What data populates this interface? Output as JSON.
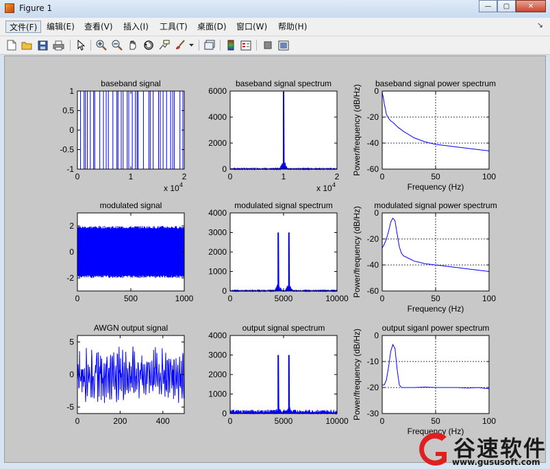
{
  "window": {
    "title": "Figure 1",
    "buttons": {
      "minimize": "—",
      "maximize": "▢",
      "close": "✕"
    }
  },
  "menu": {
    "items": [
      "文件(F)",
      "编辑(E)",
      "查看(V)",
      "插入(I)",
      "工具(T)",
      "桌面(D)",
      "窗口(W)",
      "帮助(H)"
    ],
    "overflow": "↘"
  },
  "toolbar": {
    "icons": [
      "new-figure-icon",
      "open-file-icon",
      "save-icon",
      "print-icon",
      "pointer-icon",
      "zoom-in-icon",
      "zoom-out-icon",
      "pan-icon",
      "rotate-3d-icon",
      "data-cursor-icon",
      "brush-icon",
      "link-icon",
      "colorbar-icon",
      "legend-icon",
      "hide-plot-tools-icon",
      "show-plot-tools-icon"
    ]
  },
  "colors": {
    "line": "#0000ff",
    "axes_bg": "#ffffff",
    "figure_bg": "#c8c8c8",
    "watermark_red": "#e02020"
  },
  "chart_data": [
    {
      "type": "line",
      "title": "baseband signal",
      "xlabel": "",
      "ylabel": "",
      "xlim": [
        0,
        20000
      ],
      "ylim": [
        -1,
        1
      ],
      "xticks": [
        "0",
        "1",
        "2"
      ],
      "yticks": [
        "-1",
        "-0.5",
        "0",
        "0.5",
        "1"
      ],
      "x_exponent": "x 10^4",
      "grid": false,
      "series": [
        {
          "kind": "square-wave",
          "values": [
            1,
            -1
          ]
        }
      ]
    },
    {
      "type": "line",
      "title": "baseband signal spectrum",
      "xlabel": "",
      "ylabel": "",
      "xlim": [
        0,
        20000
      ],
      "ylim": [
        0,
        6000
      ],
      "xticks": [
        "0",
        "1",
        "2"
      ],
      "yticks": [
        "0",
        "2000",
        "4000",
        "6000"
      ],
      "x_exponent": "x 10^4",
      "grid": false,
      "series": [
        {
          "kind": "spectrum",
          "peaks": [
            {
              "x": 10000,
              "y": 5950
            }
          ],
          "floor": 60
        }
      ]
    },
    {
      "type": "line",
      "title": "baseband signal power spectrum",
      "xlabel": "Frequency (Hz)",
      "ylabel": "Power/frequency (dB/Hz)",
      "xlim": [
        0,
        100
      ],
      "ylim": [
        -60,
        0
      ],
      "xticks": [
        "0",
        "50",
        "100"
      ],
      "yticks": [
        "-60",
        "-40",
        "-20",
        "0"
      ],
      "grid": true,
      "series": [
        {
          "x": [
            0,
            1,
            2,
            3,
            4,
            6,
            8,
            10,
            15,
            20,
            30,
            40,
            50,
            60,
            70,
            80,
            90,
            100
          ],
          "y": [
            -1,
            -5,
            -10,
            -14,
            -18,
            -21,
            -23,
            -24,
            -28,
            -31,
            -36,
            -39,
            -41,
            -42,
            -43,
            -44,
            -45,
            -46
          ]
        }
      ]
    },
    {
      "type": "line",
      "title": "modulated signal",
      "xlabel": "",
      "ylabel": "",
      "xlim": [
        0,
        1000
      ],
      "ylim": [
        -3,
        3
      ],
      "xticks": [
        "0",
        "500",
        "1000"
      ],
      "yticks": [
        "-2",
        "0",
        "2"
      ],
      "grid": false,
      "series": [
        {
          "kind": "modulated",
          "amplitude": 2
        }
      ]
    },
    {
      "type": "line",
      "title": "modulated signal spectrum",
      "xlabel": "",
      "ylabel": "",
      "xlim": [
        0,
        10000
      ],
      "ylim": [
        0,
        4000
      ],
      "xticks": [
        "0",
        "5000",
        "10000"
      ],
      "yticks": [
        "0",
        "1000",
        "2000",
        "3000",
        "4000"
      ],
      "grid": false,
      "series": [
        {
          "kind": "spectrum",
          "peaks": [
            {
              "x": 4500,
              "y": 3000
            },
            {
              "x": 5500,
              "y": 3000
            }
          ],
          "floor": 30
        }
      ]
    },
    {
      "type": "line",
      "title": "modulated signal power spectrum",
      "xlabel": "Frequency (Hz)",
      "ylabel": "Power/frequency (dB/Hz)",
      "xlim": [
        0,
        100
      ],
      "ylim": [
        -60,
        0
      ],
      "xticks": [
        "0",
        "50",
        "100"
      ],
      "yticks": [
        "-60",
        "-40",
        "-20",
        "0"
      ],
      "grid": true,
      "series": [
        {
          "x": [
            0,
            2,
            4,
            6,
            8,
            10,
            12,
            14,
            16,
            18,
            20,
            25,
            30,
            40,
            50,
            60,
            70,
            80,
            90,
            100
          ],
          "y": [
            -27,
            -24,
            -20,
            -14,
            -7,
            -4,
            -6,
            -16,
            -26,
            -31,
            -33,
            -35,
            -37,
            -39,
            -40,
            -41,
            -42,
            -43,
            -44,
            -45
          ]
        }
      ]
    },
    {
      "type": "line",
      "title": "AWGN output signal",
      "xlabel": "",
      "ylabel": "",
      "xlim": [
        0,
        500
      ],
      "ylim": [
        -6,
        6
      ],
      "xticks": [
        "0",
        "200",
        "400"
      ],
      "yticks": [
        "-5",
        "0",
        "5"
      ],
      "grid": false,
      "series": [
        {
          "kind": "noisy",
          "amplitude": 4
        }
      ]
    },
    {
      "type": "line",
      "title": "output signal spectrum",
      "xlabel": "",
      "ylabel": "",
      "xlim": [
        0,
        10000
      ],
      "ylim": [
        0,
        4000
      ],
      "xticks": [
        "0",
        "5000",
        "10000"
      ],
      "yticks": [
        "0",
        "1000",
        "2000",
        "3000",
        "4000"
      ],
      "grid": false,
      "series": [
        {
          "kind": "spectrum",
          "peaks": [
            {
              "x": 4500,
              "y": 3000
            },
            {
              "x": 5500,
              "y": 3000
            }
          ],
          "floor": 200
        }
      ]
    },
    {
      "type": "line",
      "title": "output siganl power spectrum",
      "xlabel": "Frequency (Hz)",
      "ylabel": "Power/frequency (dB/Hz)",
      "xlim": [
        0,
        100
      ],
      "ylim": [
        -30,
        0
      ],
      "xticks": [
        "0",
        "50",
        "100"
      ],
      "yticks": [
        "-30",
        "-20",
        "-10",
        "0"
      ],
      "grid": true,
      "series": [
        {
          "x": [
            0,
            2,
            4,
            6,
            8,
            10,
            12,
            14,
            16,
            18,
            20,
            30,
            40,
            50,
            60,
            70,
            80,
            90,
            100
          ],
          "y": [
            -19,
            -19,
            -17,
            -12,
            -6,
            -3.5,
            -5,
            -13,
            -19,
            -20,
            -20,
            -20,
            -19.8,
            -20,
            -20,
            -20,
            -20.2,
            -20,
            -20.5
          ]
        }
      ]
    }
  ],
  "watermark": {
    "name": "谷速软件",
    "url": "www.gususoft.com"
  }
}
